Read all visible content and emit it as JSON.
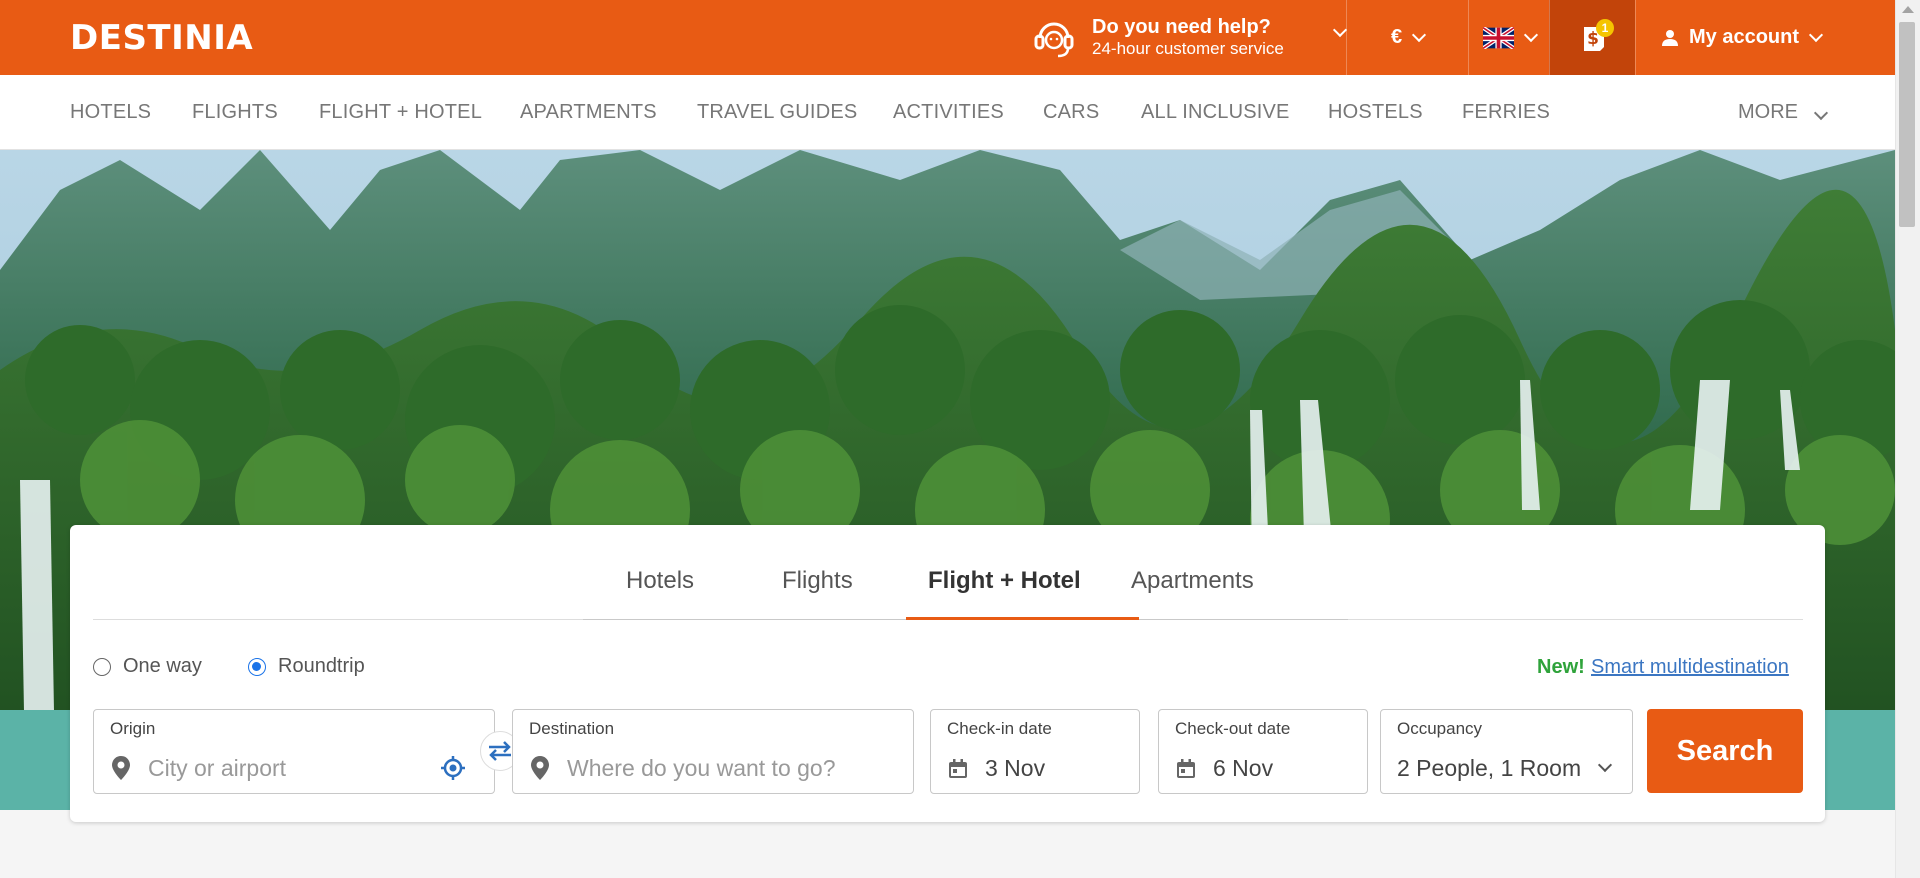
{
  "header": {
    "logo": "DESTINIA",
    "help_title": "Do you need help?",
    "help_subtitle": "24-hour customer service",
    "currency": "€",
    "wallet_badge": "1",
    "account_label": "My account"
  },
  "nav": {
    "items": [
      "HOTELS",
      "FLIGHTS",
      "FLIGHT + HOTEL",
      "APARTMENTS",
      "TRAVEL GUIDES",
      "ACTIVITIES",
      "CARS",
      "ALL INCLUSIVE",
      "HOSTELS",
      "FERRIES"
    ],
    "more": "MORE"
  },
  "search": {
    "tabs": [
      "Hotels",
      "Flights",
      "Flight + Hotel",
      "Apartments"
    ],
    "active_tab": "Flight + Hotel",
    "trip_types": [
      "One way",
      "Roundtrip"
    ],
    "selected_trip_type": "Roundtrip",
    "new_label": "New!",
    "smart_link": "Smart multidestination",
    "origin": {
      "label": "Origin",
      "placeholder": "City or airport"
    },
    "destination": {
      "label": "Destination",
      "placeholder": "Where do you want to go?"
    },
    "checkin": {
      "label": "Check-in date",
      "value": "3 Nov"
    },
    "checkout": {
      "label": "Check-out date",
      "value": "6 Nov"
    },
    "occupancy": {
      "label": "Occupancy",
      "value": "2 People, 1 Room"
    },
    "button": "Search"
  },
  "colors": {
    "brand": "#e85b14",
    "link": "#3b76c2",
    "new": "#2fa33b",
    "radio_selected": "#1a73e8"
  }
}
